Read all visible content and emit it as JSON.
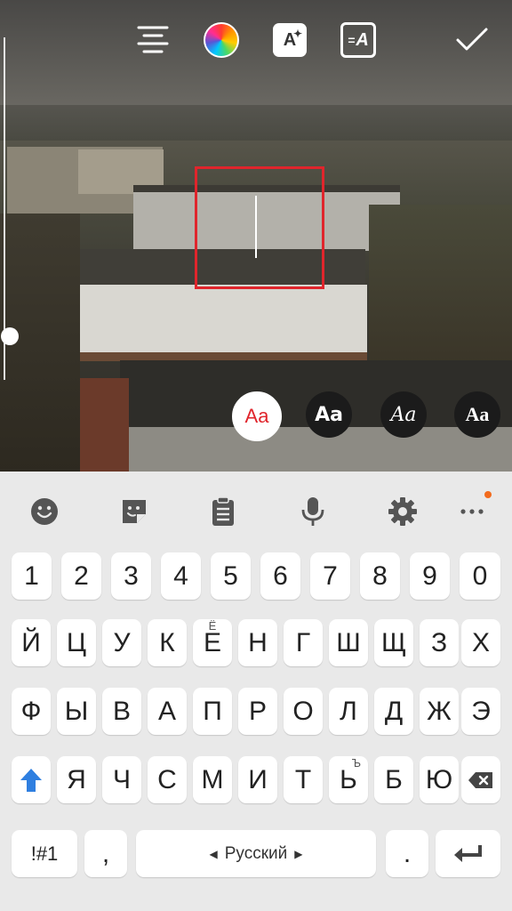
{
  "editor": {
    "toolbar": {
      "align_icon": "align-center-icon",
      "color_icon": "color-wheel-icon",
      "effects_icon": "text-effects-icon",
      "effects_label": "A",
      "background_icon": "text-background-icon",
      "background_label": "A",
      "done_icon": "checkmark-icon"
    },
    "text_value": "",
    "fonts": [
      {
        "label": "Aa",
        "style": "classic",
        "selected": true
      },
      {
        "label": "Aa",
        "style": "modern",
        "selected": false
      },
      {
        "label": "Aa",
        "style": "script",
        "selected": false
      },
      {
        "label": "Aa",
        "style": "strong",
        "selected": false
      }
    ],
    "accent_color": "#e0252c"
  },
  "keyboard": {
    "tools": [
      "emoji-icon",
      "sticker-icon",
      "clipboard-icon",
      "microphone-icon",
      "settings-icon",
      "more-icon"
    ],
    "digits": [
      "1",
      "2",
      "3",
      "4",
      "5",
      "6",
      "7",
      "8",
      "9",
      "0"
    ],
    "row1": [
      "Й",
      "Ц",
      "У",
      "К",
      "Е",
      "Н",
      "Г",
      "Ш",
      "Щ",
      "З",
      "Х"
    ],
    "row1_hint_e": "Ё",
    "row2": [
      "Ф",
      "Ы",
      "В",
      "А",
      "П",
      "Р",
      "О",
      "Л",
      "Д",
      "Ж",
      "Э"
    ],
    "row3": [
      "Я",
      "Ч",
      "С",
      "М",
      "И",
      "Т",
      "Ь",
      "Б",
      "Ю"
    ],
    "row3_hint_soft": "Ъ",
    "symbols_label": "!#1",
    "comma_label": ",",
    "language_label": "Русский",
    "period_label": ".",
    "shift_color": "#2f7fe0",
    "badge_color": "#f26b1d"
  }
}
